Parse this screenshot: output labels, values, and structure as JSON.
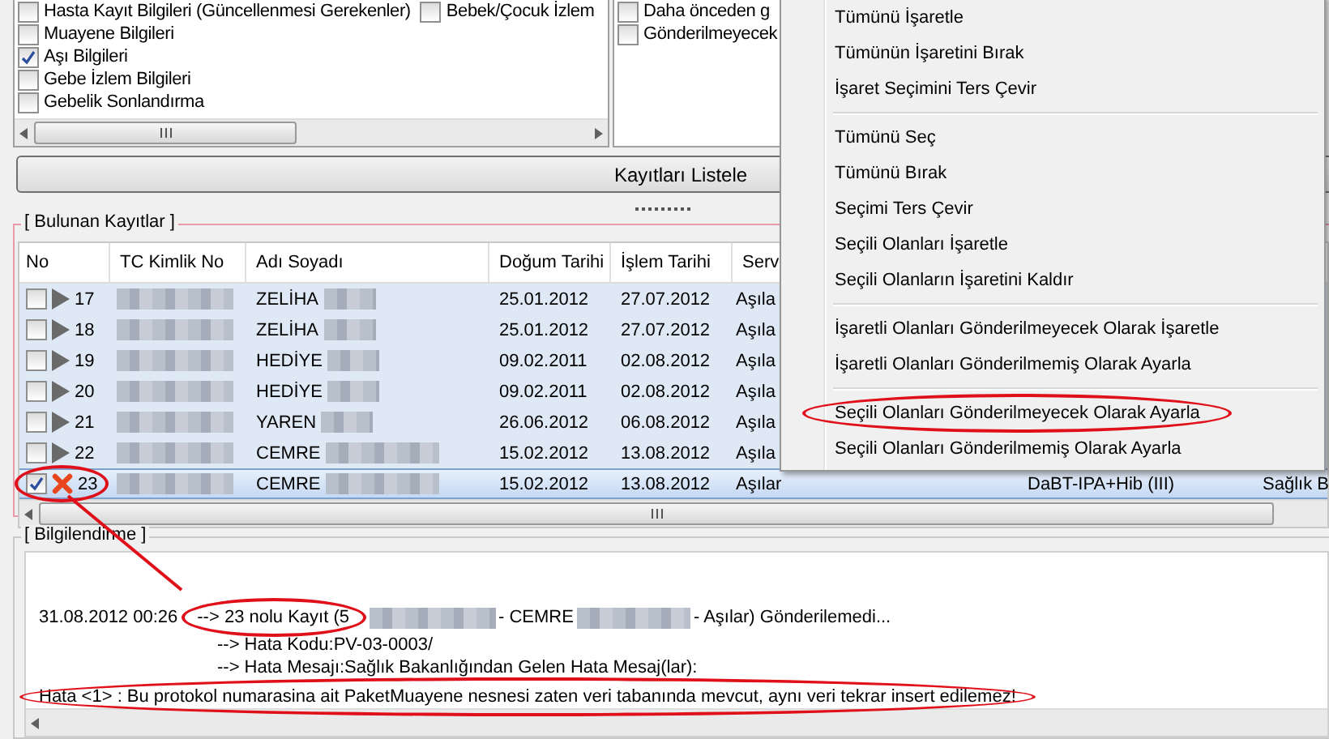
{
  "filters": {
    "columns": [
      [
        {
          "label": "Hasta Kayıt Bilgileri (Güncellenmesi Gerekenler)",
          "checked": false
        },
        {
          "label": "Muayene Bilgileri",
          "checked": false
        },
        {
          "label": "Aşı Bilgileri",
          "checked": true
        },
        {
          "label": "Gebe İzlem Bilgileri",
          "checked": false
        },
        {
          "label": "Gebelik Sonlandırma",
          "checked": false
        }
      ],
      [
        {
          "label": "Bebek/Çocuk İzlem",
          "checked": false
        }
      ]
    ],
    "options": [
      {
        "label": "Daha önceden g",
        "checked": false
      },
      {
        "label": "Gönderilmeyecek",
        "checked": false
      }
    ]
  },
  "list_button": "Kayıtları Listele",
  "records": {
    "title": "[ Bulunan Kayıtlar ]",
    "columns": [
      "No",
      "TC Kimlik No",
      "Adı Soyadı",
      "Doğum Tarihi",
      "İşlem Tarihi",
      "Serv"
    ],
    "rows": [
      {
        "no": "17",
        "kind": "pending",
        "checked": false,
        "selected": false,
        "annotated": false,
        "name": "ZELİHA",
        "birth": "25.01.2012",
        "date": "27.07.2012",
        "service": "Aşıla"
      },
      {
        "no": "18",
        "kind": "pending",
        "checked": false,
        "selected": false,
        "annotated": false,
        "name": "ZELİHA",
        "birth": "25.01.2012",
        "date": "27.07.2012",
        "service": "Aşıla"
      },
      {
        "no": "19",
        "kind": "pending",
        "checked": false,
        "selected": false,
        "annotated": false,
        "name": "HEDİYE",
        "birth": "09.02.2011",
        "date": "02.08.2012",
        "service": "Aşıla"
      },
      {
        "no": "20",
        "kind": "pending",
        "checked": false,
        "selected": false,
        "annotated": false,
        "name": "HEDİYE",
        "birth": "09.02.2011",
        "date": "02.08.2012",
        "service": "Aşıla"
      },
      {
        "no": "21",
        "kind": "pending",
        "checked": false,
        "selected": false,
        "annotated": false,
        "name": "YAREN",
        "birth": "26.06.2012",
        "date": "06.08.2012",
        "service": "Aşıla"
      },
      {
        "no": "22",
        "kind": "pending",
        "checked": false,
        "selected": false,
        "annotated": false,
        "name": "CEMRE",
        "birth": "15.02.2012",
        "date": "13.08.2012",
        "service": "Aşıla"
      },
      {
        "no": "23",
        "kind": "error",
        "checked": true,
        "selected": true,
        "annotated": true,
        "name": "CEMRE",
        "birth": "15.02.2012",
        "date": "13.08.2012",
        "service": "Aşılar",
        "column_7": "DaBT-IPA+Hib (III)",
        "column_8": "Sağlık B"
      }
    ]
  },
  "info": {
    "title": "[ Bilgilendirme ]",
    "time": "31.08.2012 00:26",
    "entry_parts": [
      "--> 23 nolu Kayıt (5",
      "- CEMRE",
      "- Aşılar)  Gönderilemedi..."
    ],
    "details": [
      "--> Hata Kodu:PV-03-0003/",
      "--> Hata Mesajı:Sağlık Bakanlığından Gelen Hata Mesaj(lar):"
    ],
    "error": "Hata <1> : Bu protokol numarasina ait PaketMuayene nesnesi zaten veri tabanında mevcut, aynı veri tekrar insert edilemez!",
    "error_annotated": true
  },
  "context_menu": {
    "groups": [
      [
        {
          "label": "Tümünü İşaretle",
          "annotated": false
        },
        {
          "label": "Tümünün İşaretini Bırak",
          "annotated": false
        },
        {
          "label": "İşaret Seçimini Ters Çevir",
          "annotated": false
        }
      ],
      [
        {
          "label": "Tümünü Seç",
          "annotated": false
        },
        {
          "label": "Tümünü Bırak",
          "annotated": false
        },
        {
          "label": "Seçimi Ters Çevir",
          "annotated": false
        },
        {
          "label": "Seçili Olanları İşaretle",
          "annotated": false
        },
        {
          "label": "Seçili Olanların İşaretini Kaldır",
          "annotated": false
        }
      ],
      [
        {
          "label": "İşaretli Olanları Gönderilmeyecek Olarak İşaretle",
          "annotated": false
        },
        {
          "label": "İşaretli Olanları Gönderilmemiş Olarak Ayarla",
          "annotated": false
        }
      ],
      [
        {
          "label": "Seçili Olanları Gönderilmeyecek Olarak Ayarla",
          "annotated": true
        },
        {
          "label": "Seçili Olanları Gönderilmemiş Olarak Ayarla",
          "annotated": false
        }
      ]
    ]
  }
}
